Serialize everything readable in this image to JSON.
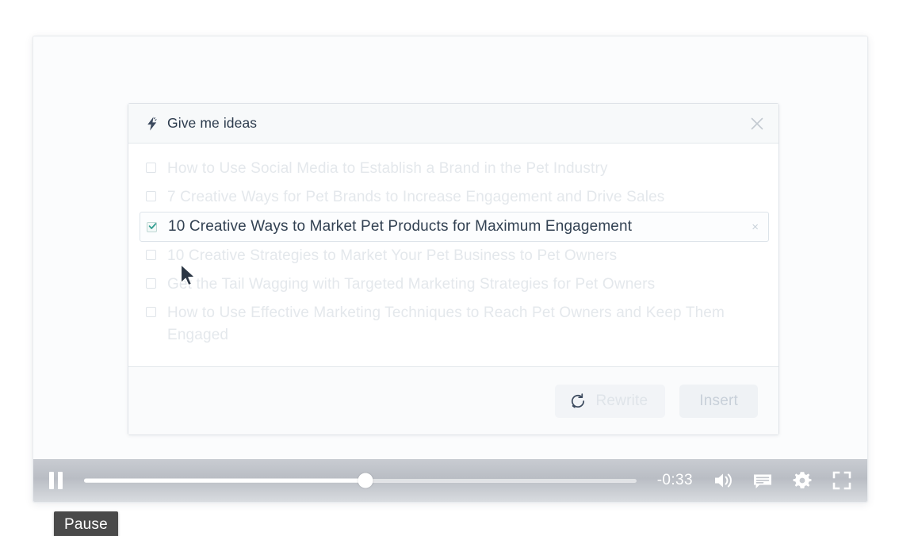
{
  "panel": {
    "title": "Give me ideas",
    "bolt_icon": "lightning-bolt-icon",
    "close_icon": "close-icon",
    "accent_color": "#2c3b4d",
    "check_color": "#2f9c8f",
    "ideas": [
      {
        "label": "How to Use Social Media to Establish a Brand in the Pet Industry",
        "checked": false,
        "selected": false
      },
      {
        "label": "7 Creative Ways for Pet Brands to Increase Engagement and Drive Sales",
        "checked": false,
        "selected": false
      },
      {
        "label": "10 Creative Ways to Market Pet Products for Maximum Engagement",
        "checked": true,
        "selected": true,
        "dismiss": "×"
      },
      {
        "label": "10 Creative Strategies to Market Your Pet Business to Pet Owners",
        "checked": false,
        "selected": false
      },
      {
        "label": "Get the Tail Wagging with Targeted Marketing Strategies for Pet Owners",
        "checked": false,
        "selected": false
      },
      {
        "label": "How to Use Effective Marketing Techniques to Reach Pet Owners and Keep Them Engaged",
        "checked": false,
        "selected": false
      }
    ],
    "footer": {
      "rewrite_label": "Rewrite",
      "rewrite_icon": "refresh-icon",
      "insert_label": "Insert"
    }
  },
  "player": {
    "pause_icon": "pause-icon",
    "time_remaining": "-0:33",
    "progress_percent": 51,
    "volume_icon": "volume-icon",
    "captions_icon": "captions-icon",
    "settings_icon": "gear-icon",
    "fullscreen_icon": "fullscreen-icon",
    "tooltip": "Pause"
  }
}
